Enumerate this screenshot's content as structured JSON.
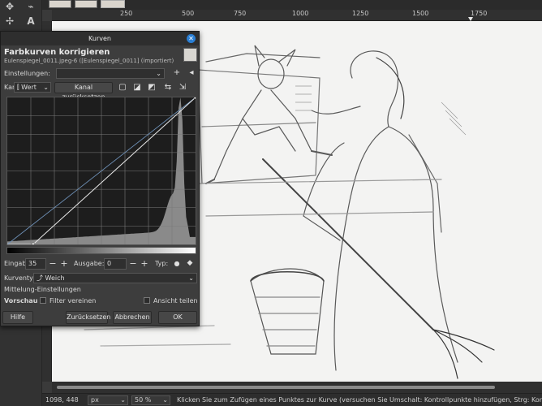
{
  "toolbox": {
    "icons": [
      "warp-transform-icon",
      "free-select-icon",
      "move-icon",
      "text-tool-icon"
    ]
  },
  "ruler": {
    "labels": [
      "250",
      "500",
      "750",
      "1000",
      "1250",
      "1500",
      "1750"
    ]
  },
  "dialog": {
    "title": "Kurven",
    "heading": "Farbkurven korrigieren",
    "subheading": "Eulenspiegel_0011.jpeg-6 ([Eulenspiegel_0011] (importiert)",
    "presets_label": "Einstellungen:",
    "channel_label": "Kanal:",
    "channel_value": "Wert",
    "reset_channel_label": "Kanal zurücksetzen",
    "input_label": "Eingabe:",
    "input_value": "35",
    "output_label": "Ausgabe:",
    "output_value": "0",
    "type_label": "Typ:",
    "curve_type_label": "Kurventyp:",
    "curve_type_value": "Weich",
    "blending_label": "Mittelung-Einstellungen",
    "preview_label": "Vorschau",
    "split_view_label": "Ansicht teilen",
    "merge_filter_label": "Filter vereinen",
    "help_label": "Hilfe",
    "reset_label": "Zurücksetzen",
    "cancel_label": "Abbrechen",
    "ok_label": "OK",
    "close_glyph": "✕",
    "add_glyph": "+",
    "minus_glyph": "−",
    "plus_glyph": "+"
  },
  "curve": {
    "points": [
      [
        35,
        0
      ],
      [
        255,
        255
      ]
    ],
    "input_range": [
      0,
      255
    ],
    "output_range": [
      0,
      255
    ]
  },
  "status": {
    "coordinates": "1098, 448",
    "unit": "px",
    "zoom": "50 %",
    "message": "Klicken Sie zum Zufügen eines Punktes zur Kurve (versuchen Sie Umschalt: Kontrollpunkte hinzufügen, Strg: Kontrollpun"
  },
  "colors": {
    "dialog_bg": "#3d3d3d",
    "accent": "#2a7fd4",
    "curve_bg": "#1d1d1d"
  }
}
